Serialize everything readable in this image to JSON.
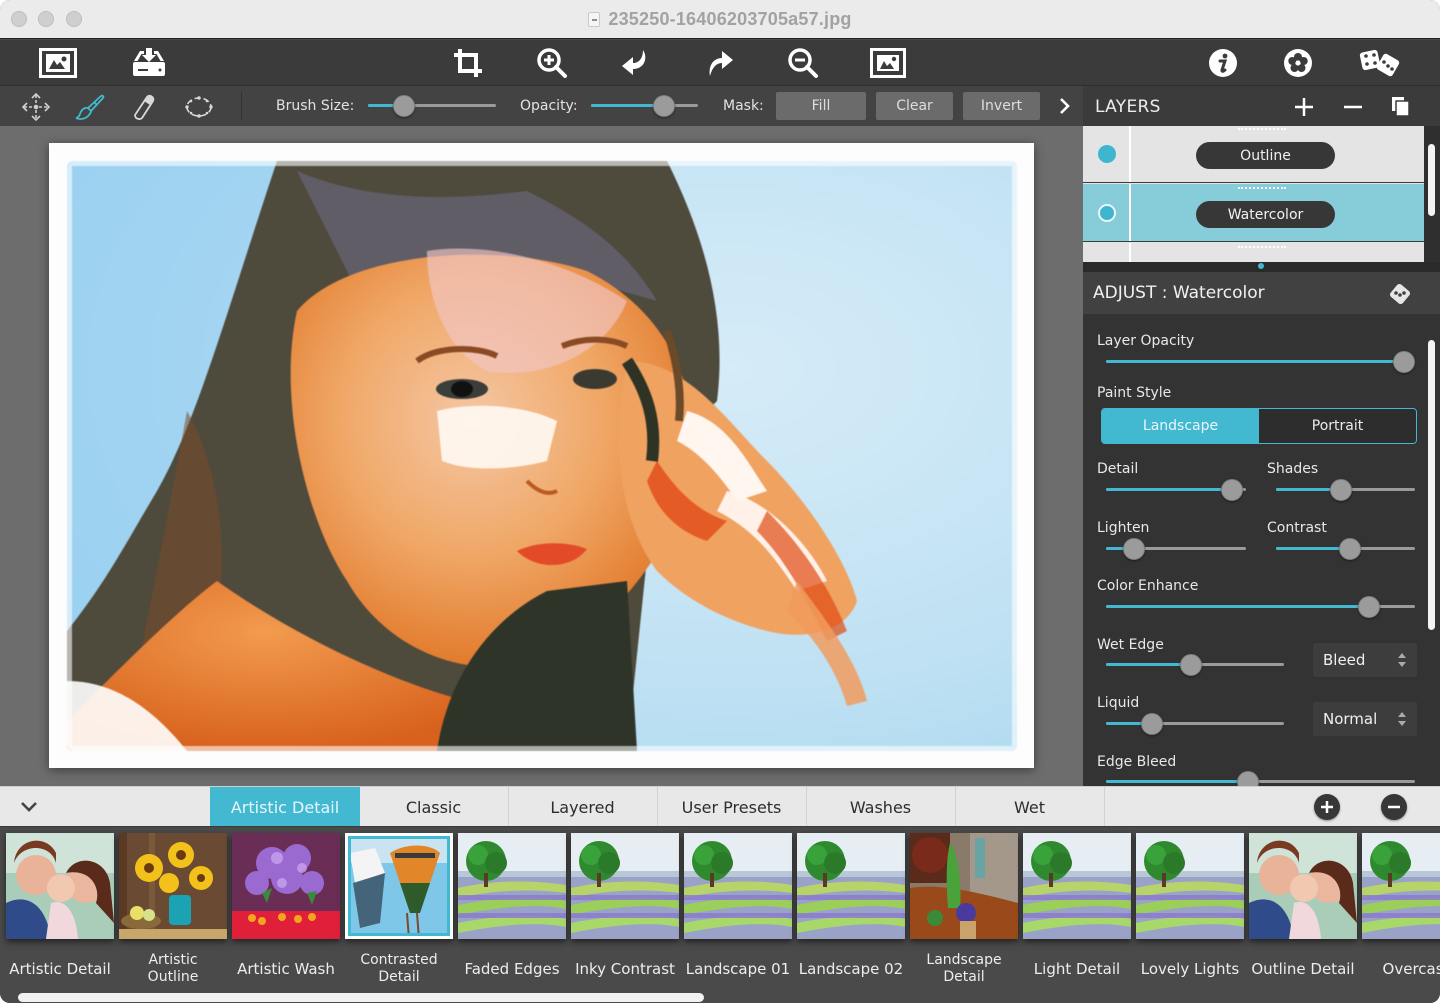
{
  "window": {
    "title": "235250-16406203705a57.jpg",
    "file_icon": "document-icon",
    "traffic_lights": [
      "close",
      "minimize",
      "zoom"
    ]
  },
  "toolbar": {
    "left": [
      {
        "name": "open-image-button",
        "icon": "image-frame-icon"
      },
      {
        "name": "save-export-button",
        "icon": "tray-download-icon"
      }
    ],
    "center": [
      {
        "name": "crop-button",
        "icon": "crop-icon"
      },
      {
        "name": "zoom-in-button",
        "icon": "zoom-in-icon"
      },
      {
        "name": "undo-button",
        "icon": "undo-arrow-icon"
      },
      {
        "name": "redo-button",
        "icon": "redo-arrow-icon"
      },
      {
        "name": "zoom-out-button",
        "icon": "zoom-out-icon"
      },
      {
        "name": "compare-original-button",
        "icon": "image-frame-icon"
      }
    ],
    "right": [
      {
        "name": "info-button",
        "icon": "info-icon"
      },
      {
        "name": "settings-button",
        "icon": "flower-gear-icon"
      },
      {
        "name": "randomize-button",
        "icon": "dice-icon"
      }
    ]
  },
  "subtoolbar": {
    "tools": [
      {
        "name": "move-tool",
        "icon": "move-arrows-icon",
        "active": false
      },
      {
        "name": "brush-tool",
        "icon": "paintbrush-icon",
        "active": true
      },
      {
        "name": "eraser-tool",
        "icon": "eraser-icon",
        "active": false
      },
      {
        "name": "lasso-tool",
        "icon": "lasso-ellipse-icon",
        "active": false
      }
    ],
    "brush_size_label": "Brush Size:",
    "brush_size_value": 0.28,
    "opacity_label": "Opacity:",
    "opacity_value": 0.68,
    "mask_label": "Mask:",
    "mask_buttons": [
      "Fill",
      "Clear",
      "Invert"
    ],
    "expand_icon": "chevron-right-icon"
  },
  "canvas": {
    "description": "Watercolor painting of a young woman with hand near face, light blue background"
  },
  "layers": {
    "title": "LAYERS",
    "add_icon": "plus-icon",
    "remove_icon": "minus-icon",
    "duplicate_icon": "duplicate-icon",
    "items": [
      {
        "label": "Outline",
        "visible": true,
        "selected": false
      },
      {
        "label": "Watercolor",
        "visible": true,
        "selected": true
      }
    ]
  },
  "adjust": {
    "title": "ADJUST : Watercolor",
    "random_icon": "dice-icon",
    "layer_opacity": {
      "label": "Layer Opacity",
      "value": 1.0
    },
    "paint_style": {
      "label": "Paint Style",
      "options": [
        "Landscape",
        "Portrait"
      ],
      "selected": "Landscape"
    },
    "detail": {
      "label": "Detail",
      "value": 0.9
    },
    "shades": {
      "label": "Shades",
      "value": 0.47
    },
    "lighten": {
      "label": "Lighten",
      "value": 0.2
    },
    "contrast": {
      "label": "Contrast",
      "value": 0.53
    },
    "color_enhance": {
      "label": "Color Enhance",
      "value": 0.85
    },
    "wet_edge": {
      "label": "Wet Edge",
      "value": 0.48,
      "mode": "Bleed"
    },
    "liquid": {
      "label": "Liquid",
      "value": 0.26,
      "mode": "Normal"
    },
    "edge_bleed": {
      "label": "Edge Bleed",
      "value": 0.46
    }
  },
  "presets": {
    "collapse_icon": "chevron-down-icon",
    "tabs": [
      {
        "label": "Artistic Detail",
        "active": true
      },
      {
        "label": "Classic",
        "active": false
      },
      {
        "label": "Layered",
        "active": false
      },
      {
        "label": "User Presets",
        "active": false
      },
      {
        "label": "Washes",
        "active": false
      },
      {
        "label": "Wet",
        "active": false
      }
    ],
    "add_icon": "plus-circle-icon",
    "remove_icon": "minus-circle-icon",
    "items": [
      {
        "label": "Artistic Detail",
        "thumb": "family",
        "selected": false
      },
      {
        "label": "Artistic\nOutline",
        "thumb": "sunflowers",
        "selected": false
      },
      {
        "label": "Artistic Wash",
        "thumb": "lilacs",
        "selected": false
      },
      {
        "label": "Contrasted\nDetail",
        "thumb": "boats",
        "selected": true
      },
      {
        "label": "Faded Edges",
        "thumb": "lavender",
        "selected": false
      },
      {
        "label": "Inky Contrast",
        "thumb": "lavender",
        "selected": false
      },
      {
        "label": "Landscape 01",
        "thumb": "lavender",
        "selected": false
      },
      {
        "label": "Landscape 02",
        "thumb": "lavender",
        "selected": false
      },
      {
        "label": "Landscape\nDetail",
        "thumb": "garden",
        "selected": false
      },
      {
        "label": "Light Detail",
        "thumb": "lavender",
        "selected": false
      },
      {
        "label": "Lovely Lights",
        "thumb": "lavender",
        "selected": false
      },
      {
        "label": "Outline Detail",
        "thumb": "family",
        "selected": false
      },
      {
        "label": "Overcast",
        "thumb": "lavender",
        "selected": false
      }
    ],
    "scroll_position": 0.0
  },
  "colors": {
    "accent": "#43b8d1",
    "toolbar_bg": "#3b3b3b",
    "panel_bg": "#333333",
    "canvas_bg": "#6d6d6d",
    "selected_layer": "#86ccd9"
  }
}
